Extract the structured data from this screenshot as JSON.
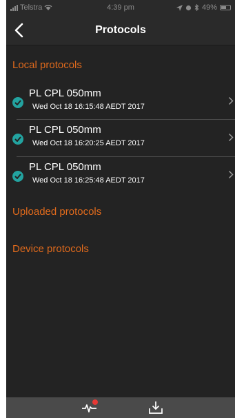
{
  "status_bar": {
    "carrier": "Telstra",
    "time": "4:39 pm",
    "battery": "49%"
  },
  "nav": {
    "title": "Protocols",
    "back_icon": "chevron-left-icon"
  },
  "sections": {
    "local": "Local protocols",
    "uploaded": "Uploaded protocols",
    "device": "Device protocols"
  },
  "protocols": [
    {
      "name": "PL CPL 050mm",
      "date": "Wed Oct 18 16:15:48 AEDT 2017"
    },
    {
      "name": "PL CPL 050mm",
      "date": "Wed Oct 18 16:20:25 AEDT 2017"
    },
    {
      "name": "PL CPL 050mm",
      "date": "Wed Oct 18 16:25:48 AEDT 2017"
    }
  ],
  "tab_bar": {
    "items": [
      "activity-icon",
      "download-icon"
    ],
    "badge_color": "#e53935"
  },
  "colors": {
    "accent": "#e06a1c",
    "check": "#23a3a0",
    "background": "#232323"
  }
}
